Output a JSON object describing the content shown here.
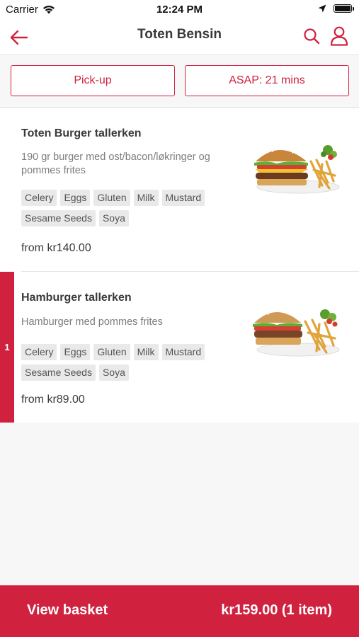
{
  "status_bar": {
    "carrier": "Carrier",
    "time": "12:24 PM"
  },
  "nav": {
    "title": "Toten Bensin"
  },
  "options": {
    "pickup_label": "Pick-up",
    "asap_label": "ASAP: 21 mins"
  },
  "menu_items": [
    {
      "name": "Toten Burger tallerken",
      "description": "190 gr burger med ost/bacon/løkringer og pommes frites",
      "allergens": [
        "Celery",
        "Eggs",
        "Gluten",
        "Milk",
        "Mustard",
        "Sesame Seeds",
        "Soya"
      ],
      "price": "from kr140.00"
    },
    {
      "name": "Hamburger tallerken",
      "description": "Hamburger med pommes frites",
      "allergens": [
        "Celery",
        "Eggs",
        "Gluten",
        "Milk",
        "Mustard",
        "Sesame Seeds",
        "Soya"
      ],
      "price": "from kr89.00",
      "quantity": "1"
    }
  ],
  "basket": {
    "label": "View basket",
    "total": "kr159.00 (1 item)"
  },
  "colors": {
    "accent": "#d0213f",
    "background": "#f7f7f7"
  }
}
